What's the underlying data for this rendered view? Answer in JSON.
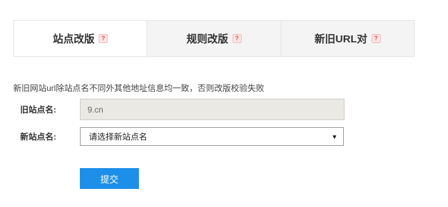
{
  "tabs": [
    {
      "label": "站点改版",
      "help": "?",
      "active": true
    },
    {
      "label": "规则改版",
      "help": "?",
      "active": false
    },
    {
      "label": "新旧URL对",
      "help": "?",
      "active": false
    }
  ],
  "notice": "新旧网站url除站点名不同外其他地址信息均一致，否则改版校验失败",
  "old_site": {
    "label": "旧站点名:",
    "value": "9.cn"
  },
  "new_site": {
    "label": "新站点名:",
    "selected": "请选择新站点名"
  },
  "submit_label": "提交",
  "colors": {
    "accent": "#1e8fe8",
    "help_icon": "#d9534f"
  }
}
